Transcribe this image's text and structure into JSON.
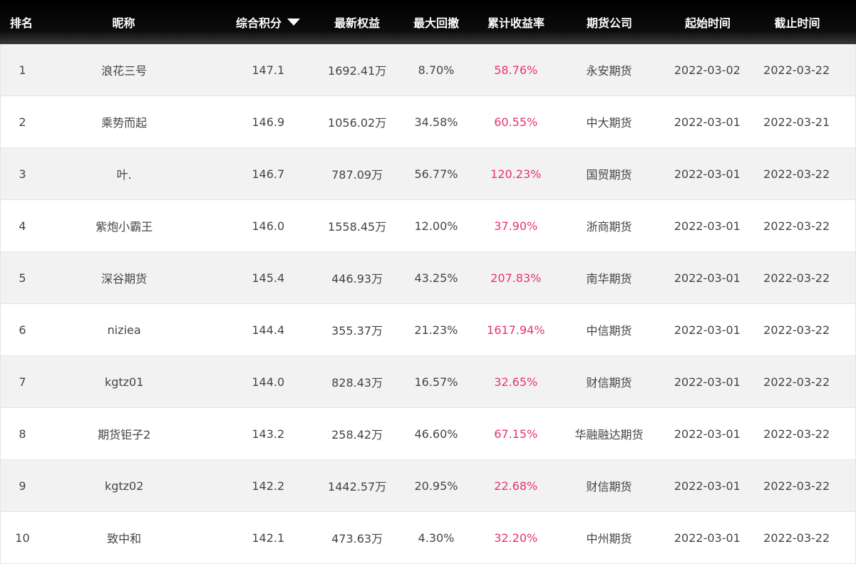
{
  "headers": {
    "rank": "排名",
    "nickname": "昵称",
    "score": "综合积分",
    "equity": "最新权益",
    "drawdown": "最大回撤",
    "return": "累计收益率",
    "company": "期货公司",
    "start": "起始时间",
    "end": "截止时间"
  },
  "sort_icon": "sort-desc-triangle-icon",
  "colors": {
    "return_text": "#e8336e",
    "header_bg": "#000000"
  },
  "rows": [
    {
      "rank": "1",
      "nickname": "浪花三号",
      "score": "147.1",
      "equity": "1692.41万",
      "drawdown": "8.70%",
      "return": "58.76%",
      "company": "永安期货",
      "start": "2022-03-02",
      "end": "2022-03-22"
    },
    {
      "rank": "2",
      "nickname": "乘势而起",
      "score": "146.9",
      "equity": "1056.02万",
      "drawdown": "34.58%",
      "return": "60.55%",
      "company": "中大期货",
      "start": "2022-03-01",
      "end": "2022-03-21"
    },
    {
      "rank": "3",
      "nickname": "叶.",
      "score": "146.7",
      "equity": "787.09万",
      "drawdown": "56.77%",
      "return": "120.23%",
      "company": "国贸期货",
      "start": "2022-03-01",
      "end": "2022-03-22"
    },
    {
      "rank": "4",
      "nickname": "紫炮小霸王",
      "score": "146.0",
      "equity": "1558.45万",
      "drawdown": "12.00%",
      "return": "37.90%",
      "company": "浙商期货",
      "start": "2022-03-01",
      "end": "2022-03-22"
    },
    {
      "rank": "5",
      "nickname": "深谷期货",
      "score": "145.4",
      "equity": "446.93万",
      "drawdown": "43.25%",
      "return": "207.83%",
      "company": "南华期货",
      "start": "2022-03-01",
      "end": "2022-03-22"
    },
    {
      "rank": "6",
      "nickname": "niziea",
      "score": "144.4",
      "equity": "355.37万",
      "drawdown": "21.23%",
      "return": "1617.94%",
      "company": "中信期货",
      "start": "2022-03-01",
      "end": "2022-03-22"
    },
    {
      "rank": "7",
      "nickname": "kgtz01",
      "score": "144.0",
      "equity": "828.43万",
      "drawdown": "16.57%",
      "return": "32.65%",
      "company": "财信期货",
      "start": "2022-03-01",
      "end": "2022-03-22"
    },
    {
      "rank": "8",
      "nickname": "期货钜子2",
      "score": "143.2",
      "equity": "258.42万",
      "drawdown": "46.60%",
      "return": "67.15%",
      "company": "华融融达期货",
      "start": "2022-03-01",
      "end": "2022-03-22"
    },
    {
      "rank": "9",
      "nickname": "kgtz02",
      "score": "142.2",
      "equity": "1442.57万",
      "drawdown": "20.95%",
      "return": "22.68%",
      "company": "财信期货",
      "start": "2022-03-01",
      "end": "2022-03-22"
    },
    {
      "rank": "10",
      "nickname": "致中和",
      "score": "142.1",
      "equity": "473.63万",
      "drawdown": "4.30%",
      "return": "32.20%",
      "company": "中州期货",
      "start": "2022-03-01",
      "end": "2022-03-22"
    }
  ]
}
